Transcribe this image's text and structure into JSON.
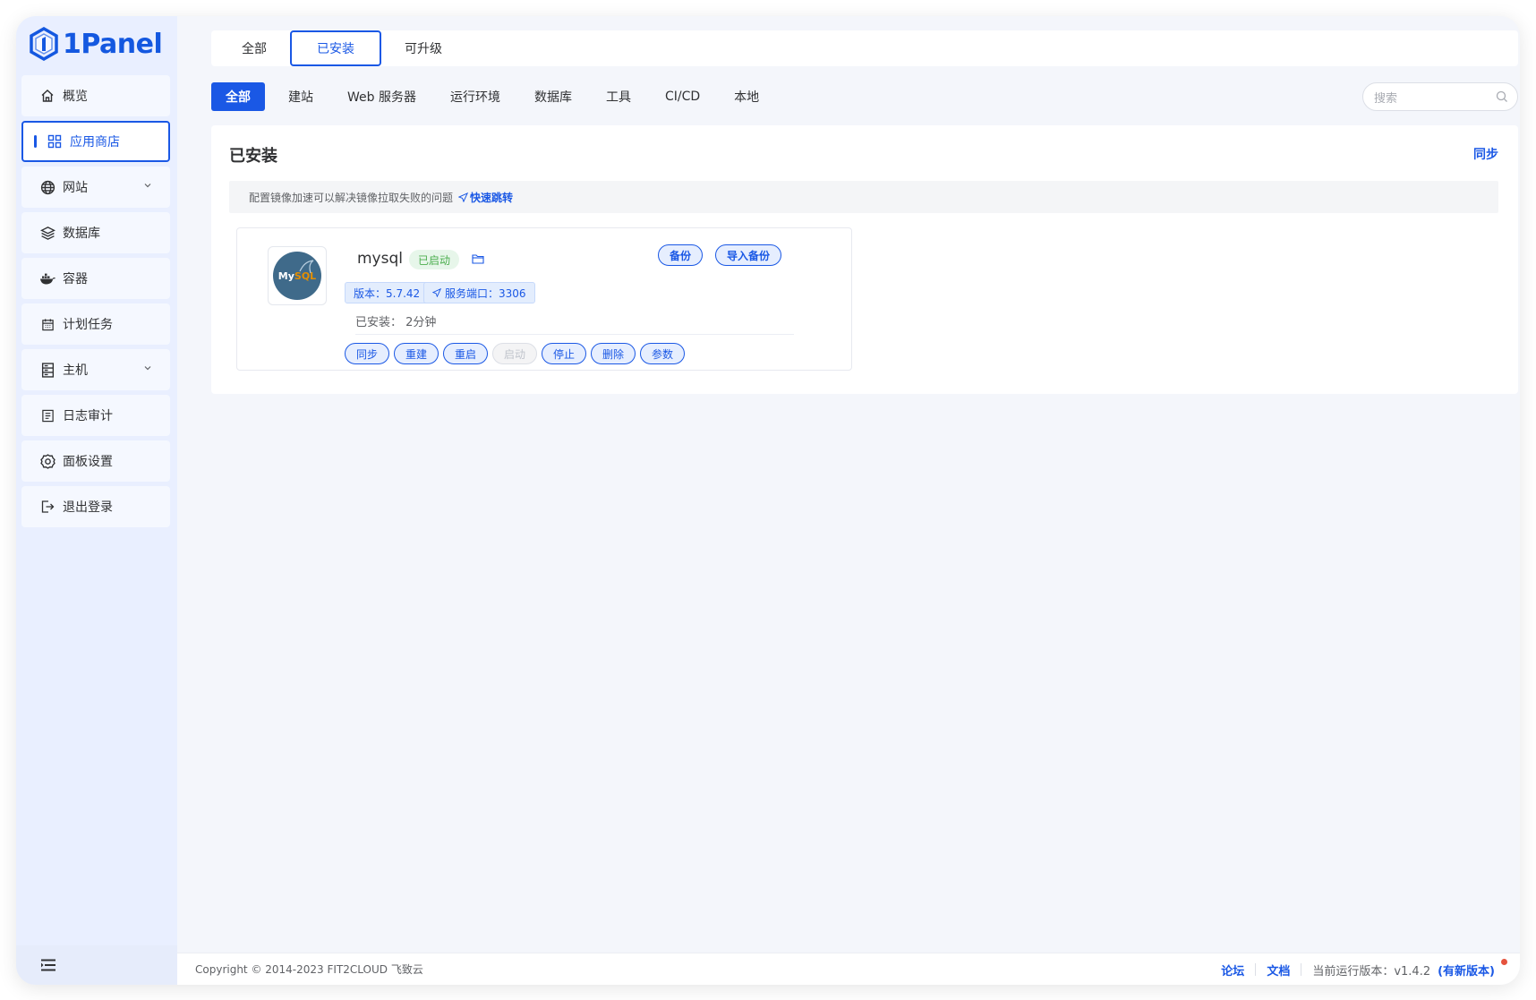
{
  "app": {
    "logo_text": "1Panel"
  },
  "sidebar": {
    "items": [
      {
        "label": "概览",
        "icon": "home-icon"
      },
      {
        "label": "应用商店",
        "icon": "apps-grid-icon"
      },
      {
        "label": "网站",
        "icon": "globe-icon"
      },
      {
        "label": "数据库",
        "icon": "layers-icon"
      },
      {
        "label": "容器",
        "icon": "docker-icon"
      },
      {
        "label": "计划任务",
        "icon": "calendar-icon"
      },
      {
        "label": "主机",
        "icon": "server-icon"
      },
      {
        "label": "日志审计",
        "icon": "log-icon"
      },
      {
        "label": "面板设置",
        "icon": "gear-icon"
      },
      {
        "label": "退出登录",
        "icon": "logout-icon"
      }
    ]
  },
  "top_tabs": [
    "全部",
    "已安装",
    "可升级"
  ],
  "categories": [
    "全部",
    "建站",
    "Web 服务器",
    "运行环境",
    "数据库",
    "工具",
    "CI/CD",
    "本地"
  ],
  "search": {
    "placeholder": "搜索"
  },
  "panel": {
    "title": "已安装",
    "sync_label": "同步",
    "notice_text": "配置镜像加速可以解决镜像拉取失败的问题",
    "notice_link": "快速跳转"
  },
  "app_card": {
    "name": "mysql",
    "status": "已启动",
    "backup_label": "备份",
    "import_backup_label": "导入备份",
    "version_tag": "版本：5.7.42",
    "port_tag": "服务端口：3306",
    "installed_label": "已安装：",
    "installed_value": "2分钟",
    "logo_text_my": "My",
    "logo_text_sql": "SQL",
    "actions": [
      "同步",
      "重建",
      "重启",
      "启动",
      "停止",
      "删除",
      "参数"
    ]
  },
  "footer": {
    "copyright": "Copyright © 2014-2023 FIT2CLOUD 飞致云",
    "forum": "论坛",
    "docs": "文档",
    "version_label": "当前运行版本：v1.4.2",
    "new_version": "(有新版本)"
  },
  "colors": {
    "primary": "#1a58e5",
    "sidebar_bg": "#e9efff",
    "success": "#4cae4f"
  }
}
